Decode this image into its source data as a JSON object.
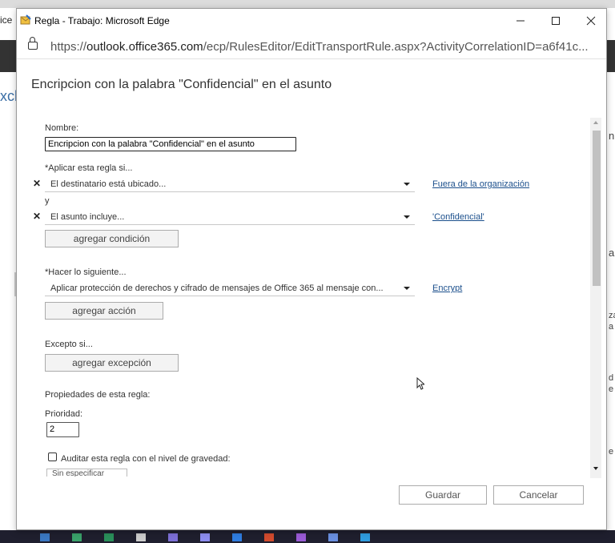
{
  "background": {
    "tab_text": "ice",
    "side_text": "xch",
    "right_fragments": [
      "n",
      "a",
      "za",
      "a",
      "d",
      "e",
      "e"
    ]
  },
  "window": {
    "title": "Regla - Trabajo: Microsoft Edge",
    "url_prefix": "https://",
    "url_host": "outlook.office365.com",
    "url_path": "/ecp/RulesEditor/EditTransportRule.aspx?ActivityCorrelationID=a6f41c..."
  },
  "dialog": {
    "title": "Encripcion con la palabra \"Confidencial\" en el asunto",
    "name_label": "Nombre:",
    "name_value": "Encripcion con la palabra \"Confidencial\" en el asunto",
    "apply_label": "*Aplicar esta regla si...",
    "condition1": "El destinatario está ubicado...",
    "condition1_value": "Fuera de la organización",
    "and_label": "y",
    "condition2": "El asunto incluye...",
    "condition2_value": "'Confidencial'",
    "add_condition": "agregar condición",
    "do_label": "*Hacer lo siguiente...",
    "action1": "Aplicar protección de derechos y cifrado de mensajes de Office 365 al mensaje con...",
    "action1_value": "Encrypt",
    "add_action": "agregar acción",
    "except_label": "Excepto si...",
    "add_exception": "agregar excepción",
    "properties_label": "Propiedades de esta regla:",
    "priority_label": "Prioridad:",
    "priority_value": "2",
    "audit_label": "Auditar esta regla con el nivel de gravedad:",
    "severity_value": "Sin especificar",
    "save": "Guardar",
    "cancel": "Cancelar"
  }
}
